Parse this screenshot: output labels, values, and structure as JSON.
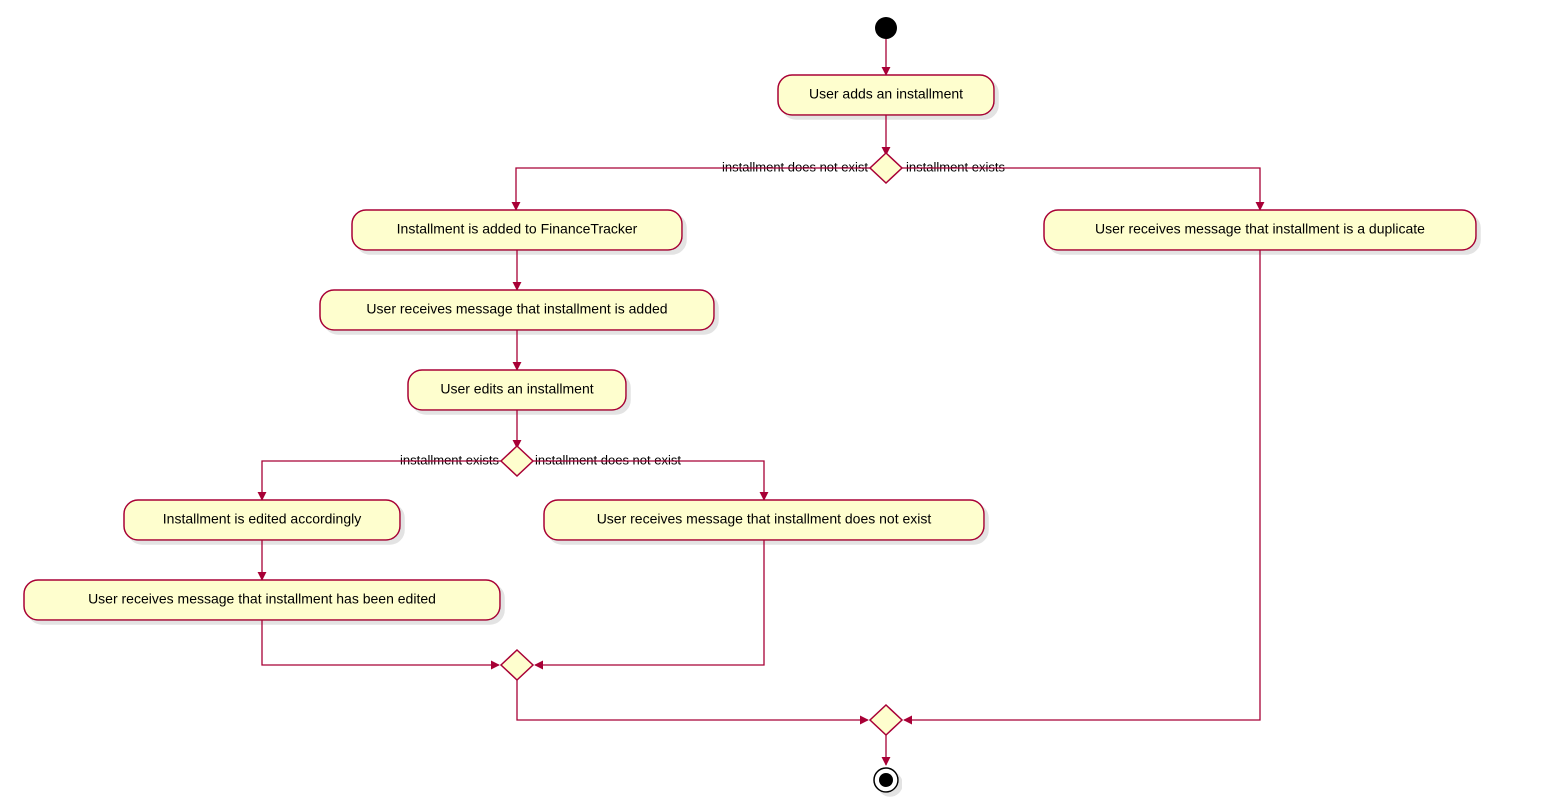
{
  "nodes": {
    "start": {
      "label": ""
    },
    "addInst": {
      "label": "User adds an installment"
    },
    "addedFT": {
      "label": "Installment is added to FinanceTracker"
    },
    "msgAdded": {
      "label": "User receives message that installment is added"
    },
    "editInst": {
      "label": "User edits an installment"
    },
    "editedOK": {
      "label": "Installment is edited accordingly"
    },
    "msgEdited": {
      "label": "User receives message that installment has been edited"
    },
    "msgNoExist": {
      "label": "User receives message that installment does not exist"
    },
    "msgDup": {
      "label": "User receives message that installment is a duplicate"
    }
  },
  "decisions": {
    "d1": {
      "left_label": "installment does not exist",
      "right_label": "installment exists"
    },
    "d2": {
      "left_label": "installment exists",
      "right_label": "installment does not exist"
    }
  }
}
